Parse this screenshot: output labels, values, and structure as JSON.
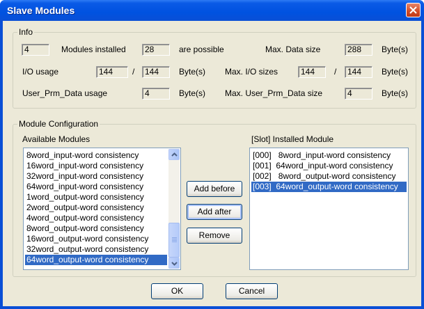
{
  "window": {
    "title": "Slave Modules"
  },
  "info": {
    "group_title": "Info",
    "modules_installed_value": "4",
    "modules_installed_label": "Modules installed",
    "modules_possible_value": "28",
    "modules_possible_label": "are possible",
    "max_data_size_label": "Max. Data size",
    "max_data_size_value": "288",
    "max_data_size_unit": "Byte(s)",
    "io_usage_label": "I/O usage",
    "io_usage_value1": "144",
    "io_usage_sep": "/",
    "io_usage_value2": "144",
    "io_usage_unit": "Byte(s)",
    "max_io_label": "Max. I/O sizes",
    "max_io_value1": "144",
    "max_io_sep": "/",
    "max_io_value2": "144",
    "max_io_unit": "Byte(s)",
    "prm_usage_label": "User_Prm_Data usage",
    "prm_usage_value": "4",
    "prm_usage_unit": "Byte(s)",
    "max_prm_label": "Max. User_Prm_Data size",
    "max_prm_value": "4",
    "max_prm_unit": "Byte(s)"
  },
  "config": {
    "group_title": "Module Configuration",
    "available_label": "Available Modules",
    "installed_label": "[Slot] Installed Module",
    "available_modules": [
      "8word_input-word consistency",
      "16word_input-word consistency",
      "32word_input-word consistency",
      "64word_input-word consistency",
      "1word_output-word consistency",
      "2word_output-word consistency",
      "4word_output-word consistency",
      "8word_output-word consistency",
      "16word_output-word consistency",
      "32word_output-word consistency",
      "64word_output-word consistency"
    ],
    "available_selected_index": 10,
    "installed_modules": [
      "[000]   8word_input-word consistency",
      "[001]  64word_input-word consistency",
      "[002]   8word_output-word consistency",
      "[003]  64word_output-word consistency"
    ],
    "installed_selected_index": 3,
    "add_before_label": "Add before",
    "add_after_label": "Add after",
    "remove_label": "Remove"
  },
  "footer": {
    "ok_label": "OK",
    "cancel_label": "Cancel"
  },
  "colors": {
    "selection": "#316ac5",
    "title_bar": "#0a4fd6",
    "dialog_bg": "#ece9d8",
    "close_button": "#d24b26"
  }
}
